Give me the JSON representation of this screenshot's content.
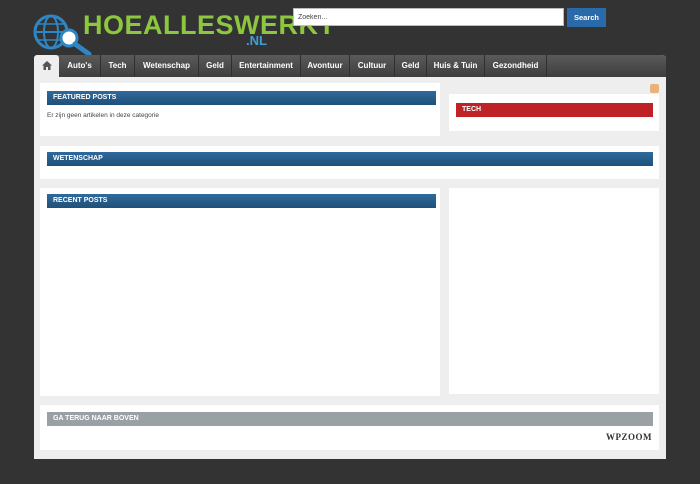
{
  "header": {
    "logo_text": "HOEALLESWERKT",
    "logo_suffix": ".NL"
  },
  "search": {
    "placeholder": "Zoeken...",
    "button_label": "Search"
  },
  "nav": {
    "items": [
      "Auto's",
      "Tech",
      "Wetenschap",
      "Geld",
      "Entertainment",
      "Avontuur",
      "Cultuur",
      "Geld",
      "Huis & Tuin",
      "Gezondheid"
    ]
  },
  "sections": {
    "featured_title": "FEATURED POSTS",
    "featured_empty": "Er zijn geen artikelen in deze categorie",
    "tech_title": "TECH",
    "wetenschap_title": "WETENSCHAP",
    "recent_title": "RECENT POSTS",
    "footer_title": "GA TERUG NAAR BOVEN"
  },
  "footer": {
    "credit": "WPZOOM"
  },
  "colors": {
    "background": "#333333",
    "accent_blue": "#1f5079",
    "accent_red": "#bf2226",
    "logo_green": "#8dc63f",
    "logo_blue": "#3ea0d8"
  }
}
